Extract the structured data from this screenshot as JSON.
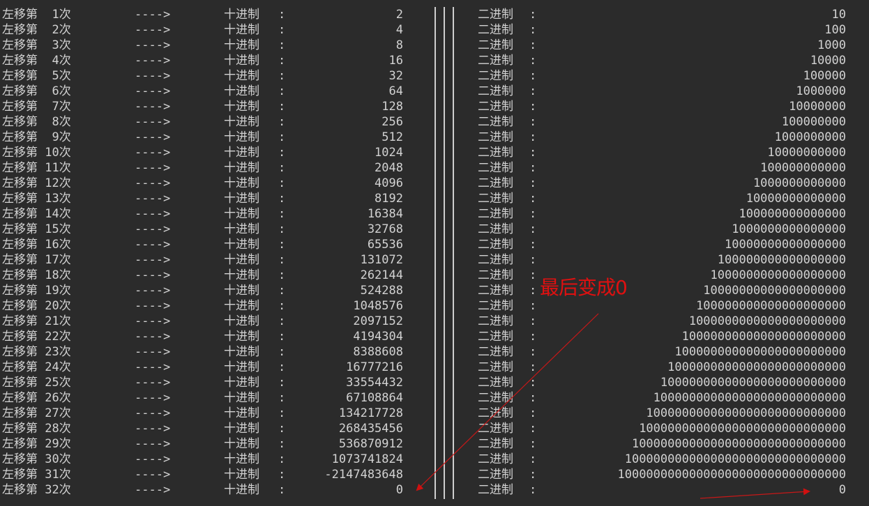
{
  "labels": {
    "arrow": "---->",
    "decimal": "十进制",
    "binary": "二进制",
    "colon": ":",
    "separator": "|||"
  },
  "annotation": {
    "text": "最后变成0",
    "color": "#e01010"
  },
  "rows": [
    {
      "label": "左移第  1次",
      "decimal": "2",
      "binary": "10"
    },
    {
      "label": "左移第  2次",
      "decimal": "4",
      "binary": "100"
    },
    {
      "label": "左移第  3次",
      "decimal": "8",
      "binary": "1000"
    },
    {
      "label": "左移第  4次",
      "decimal": "16",
      "binary": "10000"
    },
    {
      "label": "左移第  5次",
      "decimal": "32",
      "binary": "100000"
    },
    {
      "label": "左移第  6次",
      "decimal": "64",
      "binary": "1000000"
    },
    {
      "label": "左移第  7次",
      "decimal": "128",
      "binary": "10000000"
    },
    {
      "label": "左移第  8次",
      "decimal": "256",
      "binary": "100000000"
    },
    {
      "label": "左移第  9次",
      "decimal": "512",
      "binary": "1000000000"
    },
    {
      "label": "左移第 10次",
      "decimal": "1024",
      "binary": "10000000000"
    },
    {
      "label": "左移第 11次",
      "decimal": "2048",
      "binary": "100000000000"
    },
    {
      "label": "左移第 12次",
      "decimal": "4096",
      "binary": "1000000000000"
    },
    {
      "label": "左移第 13次",
      "decimal": "8192",
      "binary": "10000000000000"
    },
    {
      "label": "左移第 14次",
      "decimal": "16384",
      "binary": "100000000000000"
    },
    {
      "label": "左移第 15次",
      "decimal": "32768",
      "binary": "1000000000000000"
    },
    {
      "label": "左移第 16次",
      "decimal": "65536",
      "binary": "10000000000000000"
    },
    {
      "label": "左移第 17次",
      "decimal": "131072",
      "binary": "100000000000000000"
    },
    {
      "label": "左移第 18次",
      "decimal": "262144",
      "binary": "1000000000000000000"
    },
    {
      "label": "左移第 19次",
      "decimal": "524288",
      "binary": "10000000000000000000"
    },
    {
      "label": "左移第 20次",
      "decimal": "1048576",
      "binary": "100000000000000000000"
    },
    {
      "label": "左移第 21次",
      "decimal": "2097152",
      "binary": "1000000000000000000000"
    },
    {
      "label": "左移第 22次",
      "decimal": "4194304",
      "binary": "10000000000000000000000"
    },
    {
      "label": "左移第 23次",
      "decimal": "8388608",
      "binary": "100000000000000000000000"
    },
    {
      "label": "左移第 24次",
      "decimal": "16777216",
      "binary": "1000000000000000000000000"
    },
    {
      "label": "左移第 25次",
      "decimal": "33554432",
      "binary": "10000000000000000000000000"
    },
    {
      "label": "左移第 26次",
      "decimal": "67108864",
      "binary": "100000000000000000000000000"
    },
    {
      "label": "左移第 27次",
      "decimal": "134217728",
      "binary": "1000000000000000000000000000"
    },
    {
      "label": "左移第 28次",
      "decimal": "268435456",
      "binary": "10000000000000000000000000000"
    },
    {
      "label": "左移第 29次",
      "decimal": "536870912",
      "binary": "100000000000000000000000000000"
    },
    {
      "label": "左移第 30次",
      "decimal": "1073741824",
      "binary": "1000000000000000000000000000000"
    },
    {
      "label": "左移第 31次",
      "decimal": "-2147483648",
      "binary": "10000000000000000000000000000000"
    },
    {
      "label": "左移第 32次",
      "decimal": "0",
      "binary": "0"
    }
  ]
}
